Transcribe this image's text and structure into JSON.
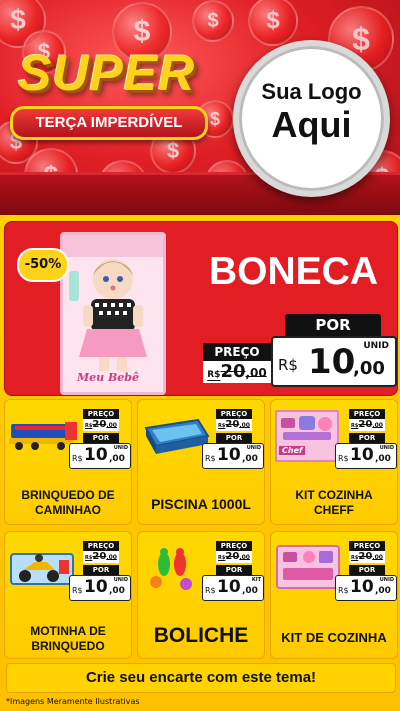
{
  "header": {
    "super": "SUPER",
    "subtitle": "TERÇA IMPERDÍVEL",
    "logo_line1": "Sua Logo",
    "logo_line2": "Aqui",
    "coin_symbol": "$"
  },
  "hero": {
    "discount": "-50%",
    "title": "BONECA",
    "box_text": "Meu Bebê",
    "preco_label": "PREÇO",
    "old_currency": "R$",
    "old_int": "20",
    "old_dec": ",00",
    "por_label": "POR",
    "unit": "UNID",
    "new_currency": "R$",
    "new_int": "10",
    "new_dec": ",00"
  },
  "products": [
    {
      "name_line1": "BRINQUEDO DE",
      "name_line2": "CAMINHAO",
      "preco_label": "PREÇO",
      "old_currency": "R$",
      "old_int": "20",
      "old_dec": ",00",
      "por_label": "POR",
      "unit": "UNID",
      "new_currency": "R$",
      "new_int": "10",
      "new_dec": ",00",
      "icon": "truck-toy-icon"
    },
    {
      "name_line1": "PISCINA 1000L",
      "name_line2": "",
      "preco_label": "PREÇO",
      "old_currency": "R$",
      "old_int": "20",
      "old_dec": ",00",
      "por_label": "POR",
      "unit": "UNID",
      "new_currency": "R$",
      "new_int": "10",
      "new_dec": ",00",
      "icon": "pool-icon"
    },
    {
      "name_line1": "KIT COZINHA",
      "name_line2": "CHEFF",
      "preco_label": "PREÇO",
      "old_currency": "R$",
      "old_int": "20",
      "old_dec": ",00",
      "por_label": "POR",
      "unit": "UNID",
      "new_currency": "R$",
      "new_int": "10",
      "new_dec": ",00",
      "icon": "kitchen-set-icon",
      "box_text": "Chef"
    },
    {
      "name_line1": "MOTINHA DE",
      "name_line2": "BRINQUEDO",
      "preco_label": "PREÇO",
      "old_currency": "R$",
      "old_int": "20",
      "old_dec": ",00",
      "por_label": "POR",
      "unit": "UNID",
      "new_currency": "R$",
      "new_int": "10",
      "new_dec": ",00",
      "icon": "toy-motorbike-icon"
    },
    {
      "name_line1": "BOLICHE",
      "name_line2": "",
      "preco_label": "PREÇO",
      "old_currency": "R$",
      "old_int": "20",
      "old_dec": ",00",
      "por_label": "POR",
      "unit": "KIT",
      "new_currency": "R$",
      "new_int": "10",
      "new_dec": ",00",
      "icon": "bowling-icon"
    },
    {
      "name_line1": "KIT DE COZINHA",
      "name_line2": "",
      "preco_label": "PREÇO",
      "old_currency": "R$",
      "old_int": "20",
      "old_dec": ",00",
      "por_label": "POR",
      "unit": "UNID",
      "new_currency": "R$",
      "new_int": "10",
      "new_dec": ",00",
      "icon": "kitchen-kit-icon"
    }
  ],
  "footer": {
    "cta": "Crie seu encarte com este tema!",
    "disclaimer": "*Imagens Meramente Ilustrativas"
  },
  "colors": {
    "red": "#e31d24",
    "yellow": "#ffd100",
    "black": "#111111"
  }
}
